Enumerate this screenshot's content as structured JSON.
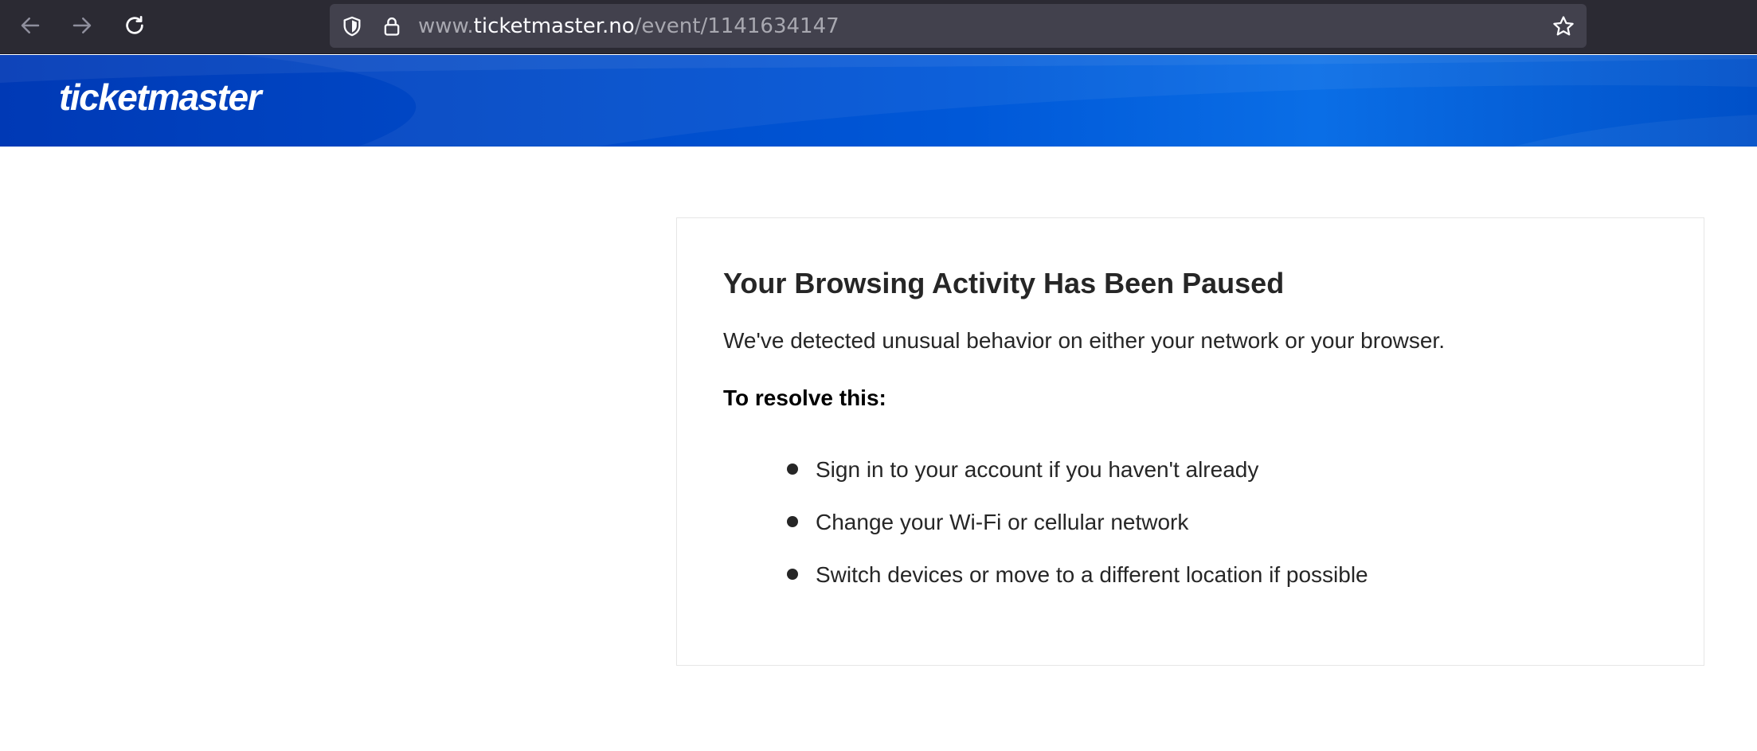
{
  "browser": {
    "url_prefix": "www.",
    "url_domain": "ticketmaster.no",
    "url_path": "/event/1141634147",
    "icons": {
      "back": "arrow-left-icon",
      "forward": "arrow-right-icon",
      "reload": "reload-icon",
      "tracking": "shield-icon",
      "security": "lock-icon",
      "bookmark": "star-icon"
    }
  },
  "header": {
    "logo": "ticketmaster",
    "brand_color": "#0049cc"
  },
  "card": {
    "title": "Your Browsing Activity Has Been Paused",
    "description": "We've detected unusual behavior on either your network or your browser.",
    "subheading": "To resolve this:",
    "steps": [
      "Sign in to your account if you haven't already",
      "Change your Wi-Fi or cellular network",
      "Switch devices or move to a different location if possible"
    ]
  }
}
